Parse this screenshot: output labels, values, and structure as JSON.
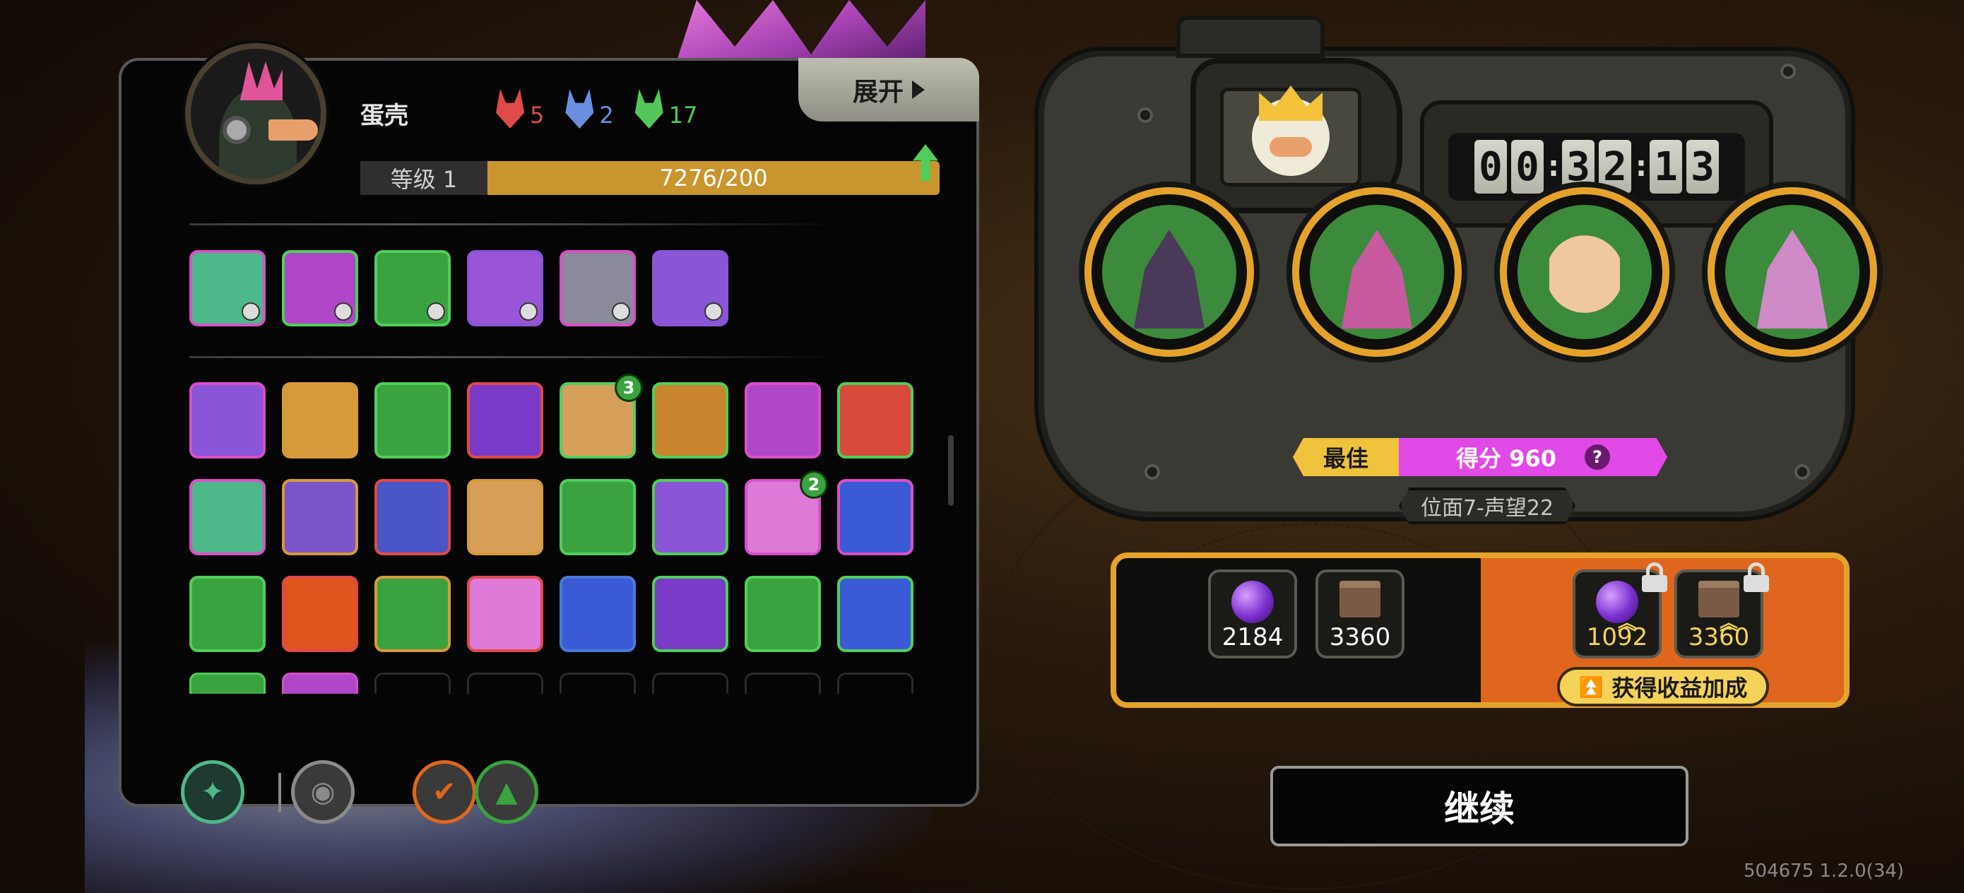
{
  "player": {
    "name": "蛋壳",
    "expand_label": "展开",
    "level_label": "等级 1",
    "xp_text": "7276/200",
    "stats": [
      {
        "name": "red-mask",
        "value": "5",
        "color": "#e04a4a"
      },
      {
        "name": "blue-mask",
        "value": "2",
        "color": "#6a8fe0"
      },
      {
        "name": "green-mask",
        "value": "17",
        "color": "#55c75a"
      }
    ]
  },
  "equipped": [
    {
      "name": "crosshair-skill",
      "bg": "#4db88a",
      "border": "#d94fc8"
    },
    {
      "name": "banner-skill",
      "bg": "#b046c8",
      "border": "#4fcf5a"
    },
    {
      "name": "green-flame-skill",
      "bg": "#3aa33f",
      "border": "#4fcf5a"
    },
    {
      "name": "hammer-skill",
      "bg": "#9a55d6",
      "border": "#8a55d6"
    },
    {
      "name": "shatter-skill",
      "bg": "#8a8a9a",
      "border": "#d94fc8"
    },
    {
      "name": "shield-skill",
      "bg": "#8a55d6",
      "border": "#8a55d6"
    }
  ],
  "inventory": [
    {
      "name": "tower-item",
      "bg": "#8a55d6",
      "border": "#d94fc8"
    },
    {
      "name": "bullet-item",
      "bg": "#d79a3a",
      "border": "#d79a3a"
    },
    {
      "name": "shard-item",
      "bg": "#3aa33f",
      "border": "#4fcf5a"
    },
    {
      "name": "moon-item",
      "bg": "#7a3ac8",
      "border": "#e04a4a"
    },
    {
      "name": "crack-item",
      "bg": "#d7a05a",
      "border": "#4fcf5a",
      "count": "3"
    },
    {
      "name": "spikes-item",
      "bg": "#c8852e",
      "border": "#4fcf5a"
    },
    {
      "name": "arrows-item",
      "bg": "#b046c8",
      "border": "#d94fc8"
    },
    {
      "name": "claw-item",
      "bg": "#d84a3a",
      "border": "#4fcf5a"
    },
    {
      "name": "blade-item",
      "bg": "#4db88a",
      "border": "#d94fc8"
    },
    {
      "name": "ghost-item",
      "bg": "#7a55c8",
      "border": "#d79a3a"
    },
    {
      "name": "mask-item",
      "bg": "#4a55c8",
      "border": "#e04a4a"
    },
    {
      "name": "sun-item",
      "bg": "#d7a05a",
      "border": "#d79a3a"
    },
    {
      "name": "wings-item",
      "bg": "#3aa33f",
      "border": "#4fcf5a"
    },
    {
      "name": "wind-item",
      "bg": "#8a55d6",
      "border": "#4fcf5a"
    },
    {
      "name": "feather-item",
      "bg": "#e07ad8",
      "border": "#d94fc8",
      "count": "2"
    },
    {
      "name": "lightning-item",
      "bg": "#3a5ad6",
      "border": "#d94fc8"
    },
    {
      "name": "demon-item",
      "bg": "#3aa33f",
      "border": "#4fcf5a"
    },
    {
      "name": "fire-face-item",
      "bg": "#e0551d",
      "border": "#e04a4a"
    },
    {
      "name": "green-shield-item",
      "bg": "#3aa33f",
      "border": "#d79a3a"
    },
    {
      "name": "pink-burst-item",
      "bg": "#e07ad8",
      "border": "#e04a4a"
    },
    {
      "name": "eye-item",
      "bg": "#3a5ad6",
      "border": "#4a7ad6"
    },
    {
      "name": "purple-spike-item",
      "bg": "#7a3ac8",
      "border": "#4fcf5a"
    },
    {
      "name": "cursor-item",
      "bg": "#3aa33f",
      "border": "#4fcf5a"
    },
    {
      "name": "waterfall-item",
      "bg": "#3a5ad6",
      "border": "#4fcf5a"
    }
  ],
  "bottom_buttons": [
    {
      "name": "skill-tab-button",
      "glyph": "✦",
      "border": "#4db88a",
      "bg": "#1f3a30"
    },
    {
      "name": "pet-tab-button",
      "glyph": "◉",
      "border": "#8a8a8a",
      "bg": "#3a3a3a"
    },
    {
      "name": "check-tab-button",
      "glyph": "✔",
      "border": "#e0661d",
      "bg": "#3a3a3a"
    },
    {
      "name": "triangle-tab-button",
      "glyph": "▲",
      "border": "#3aa33f",
      "bg": "#3a3a3a"
    }
  ],
  "timer": {
    "digits": [
      "0",
      "0",
      "3",
      "2",
      "1",
      "3"
    ]
  },
  "enemies": [
    {
      "name": "hooded-boss",
      "bg": "#3c8a3c",
      "fig": "#4a3a5a"
    },
    {
      "name": "jaw-boss",
      "bg": "#3c8a3c",
      "fig": "#c85aa0"
    },
    {
      "name": "afro-boss",
      "bg": "#3c8a3c",
      "fig": "#f0c8a0"
    },
    {
      "name": "flower-boss",
      "bg": "#3c8a3c",
      "fig": "#d08ac8"
    }
  ],
  "score": {
    "best_label": "最佳",
    "text": "得分 960",
    "help": "?"
  },
  "stage": "位面7-声望22",
  "rewards": [
    {
      "name": "orb-reward",
      "type": "orb",
      "amount": "2184"
    },
    {
      "name": "book-reward",
      "type": "book",
      "amount": "3360"
    }
  ],
  "bonus_rewards": [
    {
      "name": "orb-bonus",
      "type": "orb",
      "amount": "1092"
    },
    {
      "name": "book-bonus",
      "type": "book",
      "amount": "3360"
    }
  ],
  "bonus_label": "获得收益加成",
  "continue_label": "继续",
  "version": "504675 1.2.0(34)"
}
